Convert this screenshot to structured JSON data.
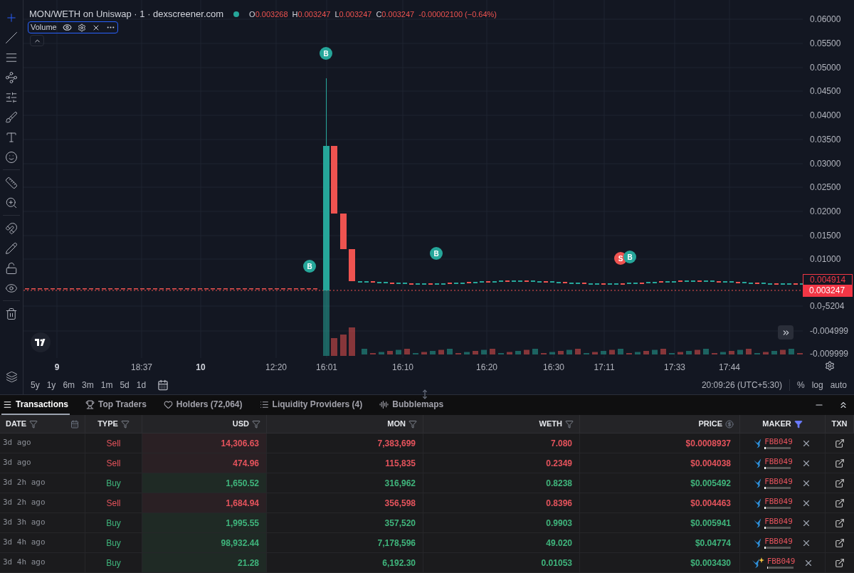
{
  "chart": {
    "title": "MON/WETH on Uniswap · 1 · dexscreener.com",
    "ohlc": [
      {
        "label": "O",
        "value": "0.003268"
      },
      {
        "label": "H",
        "value": "0.003247"
      },
      {
        "label": "L",
        "value": "0.003247"
      },
      {
        "label": "C",
        "value": "0.003247"
      }
    ],
    "change": "-0.00002100 (−0.64%)",
    "indicator": {
      "name": "Volume"
    },
    "price_ticks": [
      "0.06000",
      "0.05500",
      "0.05000",
      "0.04500",
      "0.04000",
      "0.03500",
      "0.03000",
      "0.02500",
      "0.02000",
      "0.01500",
      "0.01000",
      "0.0$_{7}$5204",
      "-0.004999",
      "-0.009999"
    ],
    "price_tags": [
      {
        "value": "0.004914",
        "kind": "outline"
      },
      {
        "value": "0.003247",
        "kind": "filled"
      }
    ],
    "time_ticks": [
      {
        "label": "9",
        "major": true
      },
      {
        "label": "18:37",
        "major": false
      },
      {
        "label": "10",
        "major": true
      },
      {
        "label": "12:20",
        "major": false
      },
      {
        "label": "16:01",
        "major": false
      },
      {
        "label": "16:10",
        "major": false
      },
      {
        "label": "16:20",
        "major": false
      },
      {
        "label": "16:30",
        "major": false
      },
      {
        "label": "17:11",
        "major": false
      },
      {
        "label": "17:33",
        "major": false
      },
      {
        "label": "17:44",
        "major": false
      }
    ],
    "markers": [
      {
        "text": "B",
        "kind": "buy"
      },
      {
        "text": "B",
        "kind": "buy"
      },
      {
        "text": "B",
        "kind": "buy"
      },
      {
        "text": "S",
        "kind": "sell"
      },
      {
        "text": "B",
        "kind": "buy"
      }
    ],
    "ranges": [
      "5y",
      "1y",
      "6m",
      "3m",
      "1m",
      "5d",
      "1d"
    ],
    "clock": "20:09:26 (UTC+5:30)",
    "scale_options": [
      "%",
      "log",
      "auto"
    ]
  },
  "tabs": [
    {
      "label": "Transactions",
      "selected": true
    },
    {
      "label": "Top Traders",
      "selected": false
    },
    {
      "label": "Holders (72,064)",
      "selected": false
    },
    {
      "label": "Liquidity Providers (4)",
      "selected": false
    },
    {
      "label": "Bubblemaps",
      "selected": false
    }
  ],
  "table": {
    "columns": [
      {
        "label": "DATE",
        "filter": true,
        "filter_active": false
      },
      {
        "label": "TYPE",
        "filter": true,
        "filter_active": false
      },
      {
        "label": "USD",
        "filter": true,
        "filter_active": false
      },
      {
        "label": "MON",
        "filter": true,
        "filter_active": false
      },
      {
        "label": "WETH",
        "filter": true,
        "filter_active": false
      },
      {
        "label": "PRICE",
        "filter": false
      },
      {
        "label": "MAKER",
        "filter": true,
        "filter_active": true
      },
      {
        "label": "TXN",
        "filter": false
      }
    ],
    "rows": [
      {
        "date": "3d ago",
        "type": "Sell",
        "kind": "sell",
        "usd": "14,306.63",
        "mon": "7,383,699",
        "weth": "7.080",
        "price": "$0.0008937",
        "maker": "FBB049",
        "new": false,
        "level": 0.05
      },
      {
        "date": "3d ago",
        "type": "Sell",
        "kind": "sell",
        "usd": "474.96",
        "mon": "115,835",
        "weth": "0.2349",
        "price": "$0.004038",
        "maker": "FBB049",
        "new": false,
        "level": 0.05
      },
      {
        "date": "3d 2h ago",
        "type": "Buy",
        "kind": "buy",
        "usd": "1,650.52",
        "mon": "316,962",
        "weth": "0.8238",
        "price": "$0.005492",
        "maker": "FBB049",
        "new": false,
        "level": 0.05
      },
      {
        "date": "3d 2h ago",
        "type": "Sell",
        "kind": "sell",
        "usd": "1,684.94",
        "mon": "356,598",
        "weth": "0.8396",
        "price": "$0.004463",
        "maker": "FBB049",
        "new": false,
        "level": 0.05
      },
      {
        "date": "3d 3h ago",
        "type": "Buy",
        "kind": "buy",
        "usd": "1,995.55",
        "mon": "357,520",
        "weth": "0.9903",
        "price": "$0.005941",
        "maker": "FBB049",
        "new": false,
        "level": 0.05
      },
      {
        "date": "3d 4h ago",
        "type": "Buy",
        "kind": "buy",
        "usd": "98,932.44",
        "mon": "7,178,596",
        "weth": "49.020",
        "price": "$0.04774",
        "maker": "FBB049",
        "new": false,
        "level": 0.05
      },
      {
        "date": "3d 4h ago",
        "type": "Buy",
        "kind": "buy",
        "usd": "21.28",
        "mon": "6,192.30",
        "weth": "0.01053",
        "price": "$0.003430",
        "maker": "FBB049",
        "new": true,
        "level": 0.05
      }
    ]
  }
}
